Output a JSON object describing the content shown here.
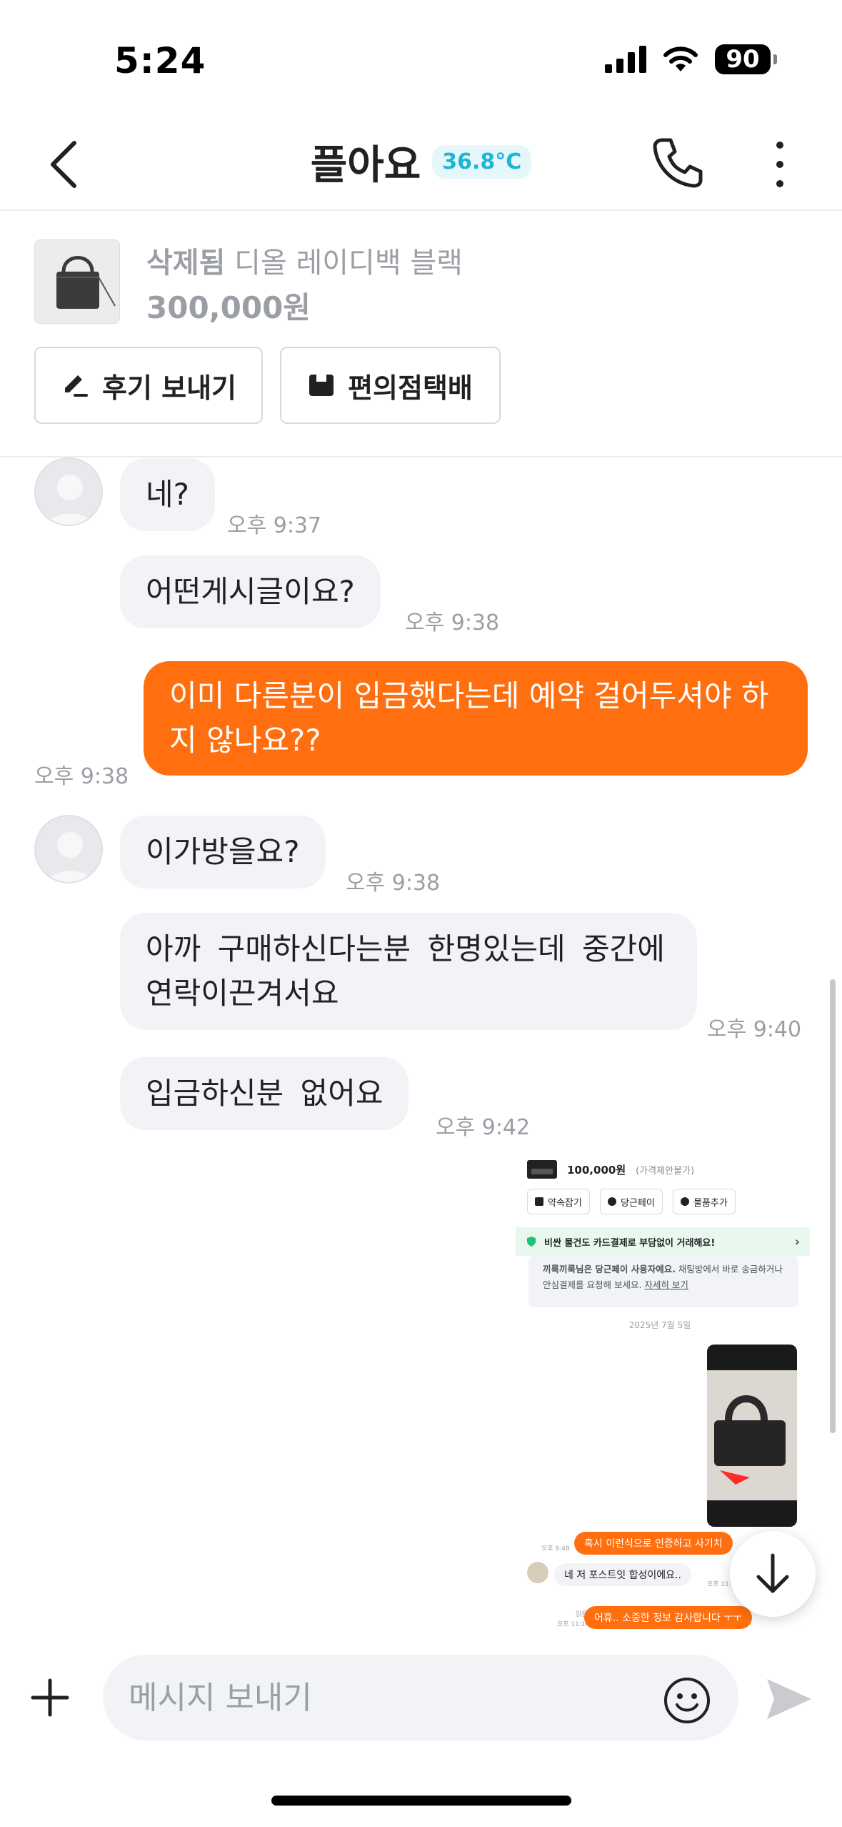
{
  "status_bar": {
    "time": "5:24",
    "battery": "90"
  },
  "header": {
    "title": "플아요",
    "temperature": "36.8°C"
  },
  "product": {
    "status": "삭제됨",
    "name": "디올 레이디백 블랙",
    "price": "300,000원",
    "review_button": "후기 보내기",
    "delivery_button": "편의점택배"
  },
  "messages": [
    {
      "side": "in",
      "text": "네?",
      "time": "오후 9:37"
    },
    {
      "side": "in",
      "text": "어떤게시글이요?",
      "time": "오후 9:38"
    },
    {
      "side": "out",
      "text": "이미 다른분이 입금했다는데 예약 걸어두셔야 하지 않나요??",
      "time": "오후 9:38"
    },
    {
      "side": "in",
      "text": "이가방을요?",
      "time": "오후 9:38"
    },
    {
      "side": "in",
      "text": "아까 구매하신다는분 한명있는데 중간에 연락이끈겨서요",
      "time": "오후 9:40"
    },
    {
      "side": "in",
      "text": "입금하신분 없어요",
      "time": "오후 9:42"
    }
  ],
  "shared_image": {
    "price": "100,000원",
    "price_note": "(가격제안불가)",
    "buttons": [
      "약속잡기",
      "당근페이",
      "물품추가"
    ],
    "banner": "비싼 물건도 카드결제로 부담없이 거래해요!",
    "notice_bold": "끼룩끼룩님은 당근페이 사용자예요.",
    "notice_text": " 채팅방에서 바로 송금하거나 안심결제를 요청해 보세요.",
    "notice_link": "자세히 보기",
    "date": "2025년 7월 5일",
    "chat": [
      {
        "side": "out",
        "text": "혹시 이런식으로 인증하고 사기치",
        "time": "오후 9:48"
      },
      {
        "side": "in",
        "text": "네 저 포스트잇 합성이에요..",
        "time": "오후 11:"
      },
      {
        "side": "out",
        "text": "어휴.. 소중한 정보 감사합니다 ㅜㅜ",
        "read": "읽음",
        "time": "오후 11:14"
      }
    ]
  },
  "input": {
    "placeholder": "메시지 보내기"
  },
  "colors": {
    "accent": "#ff6f0f",
    "bubble_in": "#f2f3f6",
    "muted": "#9b9ea5",
    "temp": "#1fb5d6"
  }
}
